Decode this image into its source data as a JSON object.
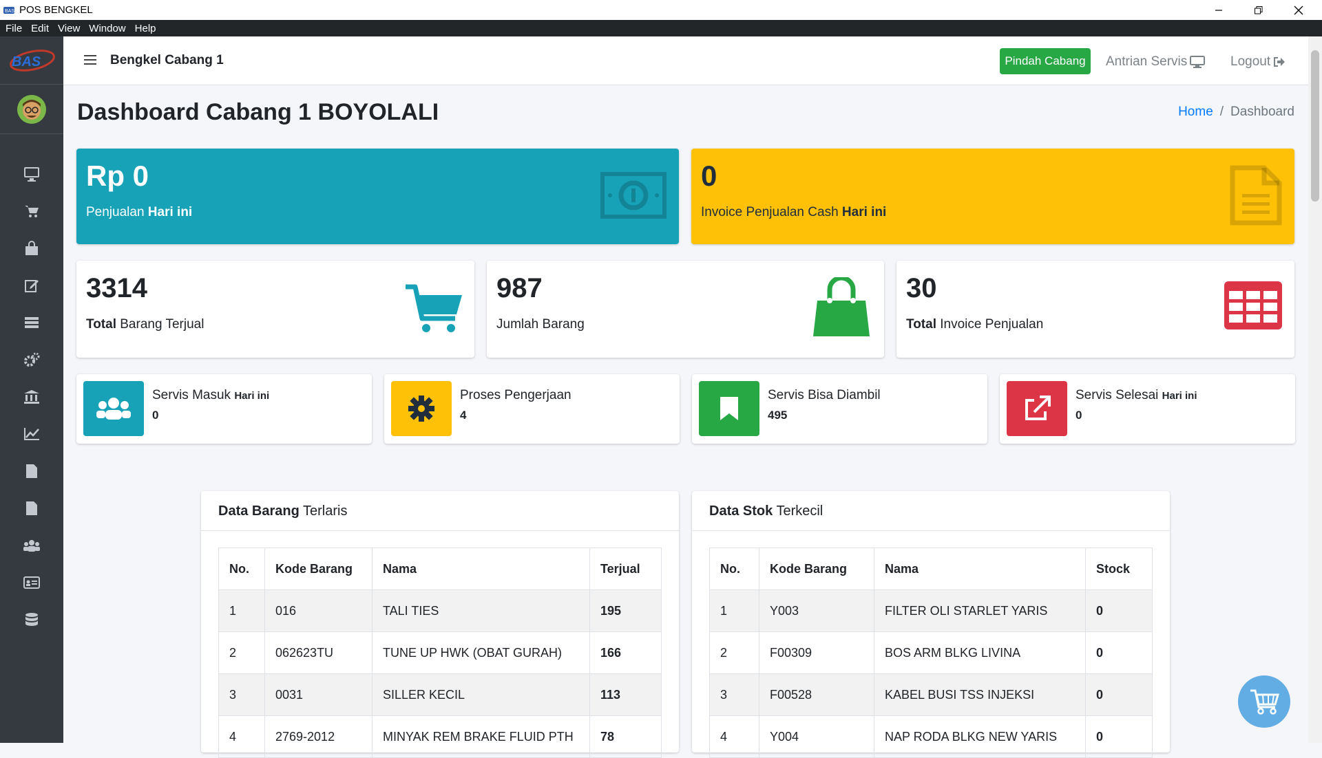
{
  "window": {
    "title": "POS BENGKEL",
    "menu": [
      "File",
      "Edit",
      "View",
      "Window",
      "Help"
    ]
  },
  "header": {
    "branch": "Bengkel Cabang 1",
    "pindah_label": "Pindah Cabang",
    "antrian_label": "Antrian Servis",
    "logout_label": "Logout"
  },
  "page": {
    "title": "Dashboard Cabang 1 BOYOLALI",
    "breadcrumb_home": "Home",
    "breadcrumb_sep": "/",
    "breadcrumb_current": "Dashboard"
  },
  "stats": {
    "penjualan": {
      "value": "Rp 0",
      "label_a": "Penjualan ",
      "label_b": "Hari ini",
      "color": "#17a2b8"
    },
    "invoice_cash": {
      "value": "0",
      "label_a": "Invoice Penjualan Cash ",
      "label_b": "Hari ini",
      "color": "#ffc107"
    },
    "barang_terjual": {
      "value": "3314",
      "label_a": "Total",
      "label_b": " Barang Terjual"
    },
    "jumlah_barang": {
      "value": "987",
      "label": "Jumlah Barang"
    },
    "invoice_total": {
      "value": "30",
      "label_a": "Total",
      "label_b": " Invoice Penjualan"
    }
  },
  "servis": [
    {
      "label": "Servis Masuk ",
      "sub": "Hari ini",
      "value": "0",
      "color": "#17a2b8"
    },
    {
      "label": "Proses Pengerjaan",
      "sub": "",
      "value": "4",
      "color": "#ffc107"
    },
    {
      "label": "Servis Bisa Diambil",
      "sub": "",
      "value": "495",
      "color": "#28a745"
    },
    {
      "label": "Servis Selesai ",
      "sub": "Hari ini",
      "value": "0",
      "color": "#dc3545"
    }
  ],
  "terlaris": {
    "title_bold": "Data Barang",
    "title_rest": " Terlaris",
    "headers": [
      "No.",
      "Kode Barang",
      "Nama",
      "Terjual"
    ],
    "rows": [
      [
        "1",
        "016",
        "TALI TIES",
        "195"
      ],
      [
        "2",
        "062623TU",
        "TUNE UP HWK (OBAT GURAH)",
        "166"
      ],
      [
        "3",
        "0031",
        "SILLER KECIL",
        "113"
      ],
      [
        "4",
        "2769-2012",
        "MINYAK REM BRAKE FLUID PTH",
        "78"
      ]
    ]
  },
  "stok": {
    "title_bold": "Data Stok",
    "title_rest": " Terkecil",
    "headers": [
      "No.",
      "Kode Barang",
      "Nama",
      "Stock"
    ],
    "rows": [
      [
        "1",
        "Y003",
        "FILTER OLI STARLET YARIS",
        "0"
      ],
      [
        "2",
        "F00309",
        "BOS ARM BLKG LIVINA",
        "0"
      ],
      [
        "3",
        "F00528",
        "KABEL BUSI TSS INJEKSI",
        "0"
      ],
      [
        "4",
        "Y004",
        "NAP RODA BLKG NEW YARIS",
        "0"
      ]
    ]
  }
}
